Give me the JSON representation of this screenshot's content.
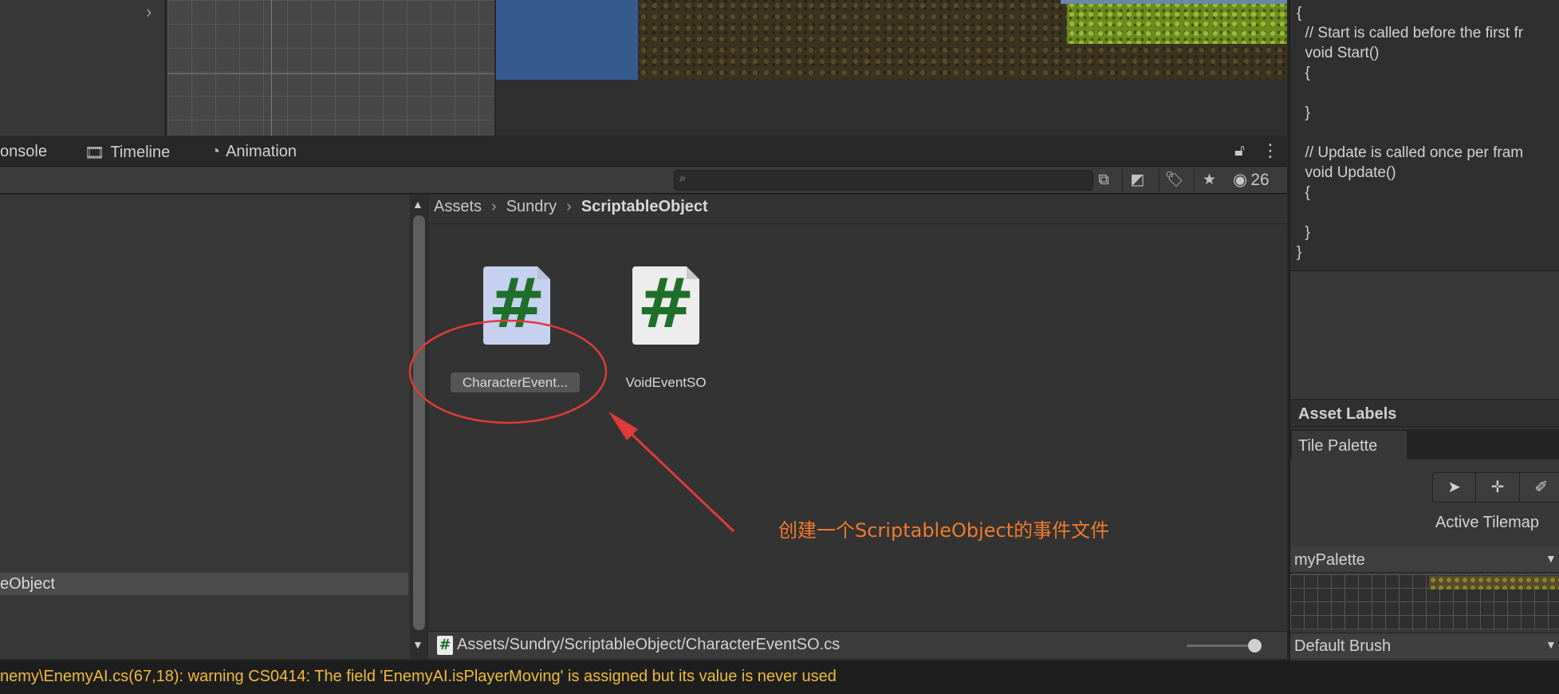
{
  "code_panel": {
    "lines": "{\n  // Start is called before the first fr\n  void Start()\n  {\n\n  }\n\n  // Update is called once per fram\n  void Update()\n  {\n\n  }\n}"
  },
  "tabs": {
    "console": "onsole",
    "timeline": "Timeline",
    "animation": "Animation"
  },
  "toolbar": {
    "search_placeholder": "",
    "eye_count": "26"
  },
  "project": {
    "left_selected_item": "eObject",
    "breadcrumb": [
      "Assets",
      "Sundry",
      "ScriptableObject"
    ],
    "files": [
      {
        "name": "CharacterEvent...",
        "icon": "csharp-script-icon",
        "selected": true
      },
      {
        "name": "VoidEventSO",
        "icon": "csharp-script-icon",
        "selected": false
      }
    ],
    "selected_path": "Assets/Sundry/ScriptableObject/CharacterEventSO.cs"
  },
  "annotation": {
    "text": "创建一个ScriptableObject的事件文件",
    "color": "#f07a2c",
    "circle_color": "#e03a3a"
  },
  "status": {
    "text": "nemy\\EnemyAI.cs(67,18): warning CS0414: The field 'EnemyAI.isPlayerMoving' is assigned but its value is never used",
    "color": "#f0bb3a"
  },
  "inspector": {
    "asset_labels": "Asset Labels",
    "tile_palette_tab": "Tile Palette",
    "active_tilemap": "Active Tilemap",
    "palette_name": "myPalette",
    "brush_name": "Default Brush"
  }
}
